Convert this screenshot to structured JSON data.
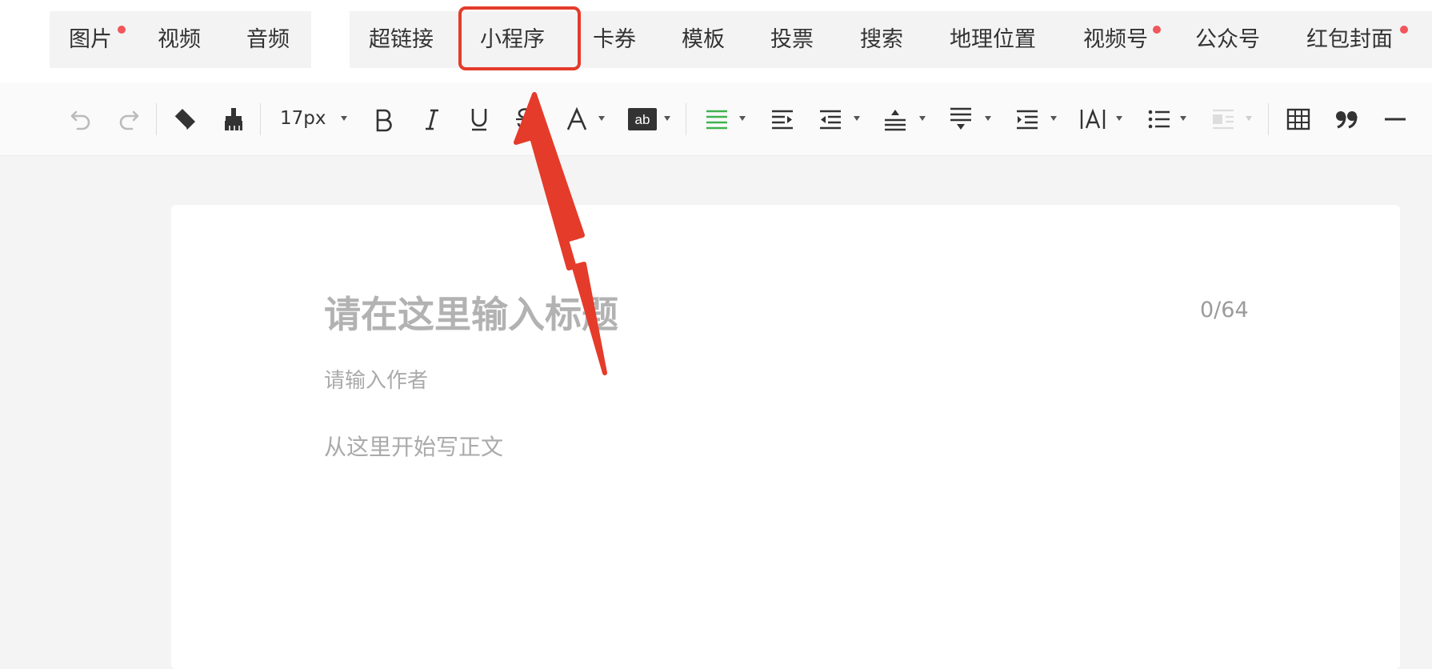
{
  "media_tabs": [
    {
      "label": "图片",
      "badge": true
    },
    {
      "label": "视频",
      "badge": false
    },
    {
      "label": "音频",
      "badge": false
    }
  ],
  "insert_tabs": [
    {
      "label": "超链接",
      "badge": false
    },
    {
      "label": "小程序",
      "badge": false
    },
    {
      "label": "卡券",
      "badge": false
    },
    {
      "label": "模板",
      "badge": false
    },
    {
      "label": "投票",
      "badge": false
    },
    {
      "label": "搜索",
      "badge": false
    },
    {
      "label": "地理位置",
      "badge": false
    },
    {
      "label": "视频号",
      "badge": true
    },
    {
      "label": "公众号",
      "badge": false
    },
    {
      "label": "红包封面",
      "badge": true
    }
  ],
  "toolbar": {
    "font_size": "17px",
    "icons": [
      "undo-icon",
      "redo-icon",
      "eraser-icon",
      "format-painter-icon",
      "bold-icon",
      "italic-icon",
      "underline-icon",
      "strikethrough-icon",
      "font-color-icon",
      "background-color-icon",
      "align-icon",
      "indent-icon",
      "outdent-icon",
      "line-spacing-icon",
      "paragraph-spacing-icon",
      "indent-spacing-icon",
      "letter-spacing-icon",
      "list-icon",
      "image-layout-icon",
      "table-icon",
      "quote-icon",
      "divider-icon"
    ]
  },
  "editor": {
    "title_placeholder": "请在这里输入标题",
    "title_counter": "0/64",
    "author_placeholder": "请输入作者",
    "body_placeholder": "从这里开始写正文"
  },
  "colors": {
    "accent_green": "#3fb34f",
    "badge_red": "#f0565a",
    "annotation_red": "#e53b2a"
  },
  "annotation": {
    "highlighted_tab": "小程序"
  }
}
